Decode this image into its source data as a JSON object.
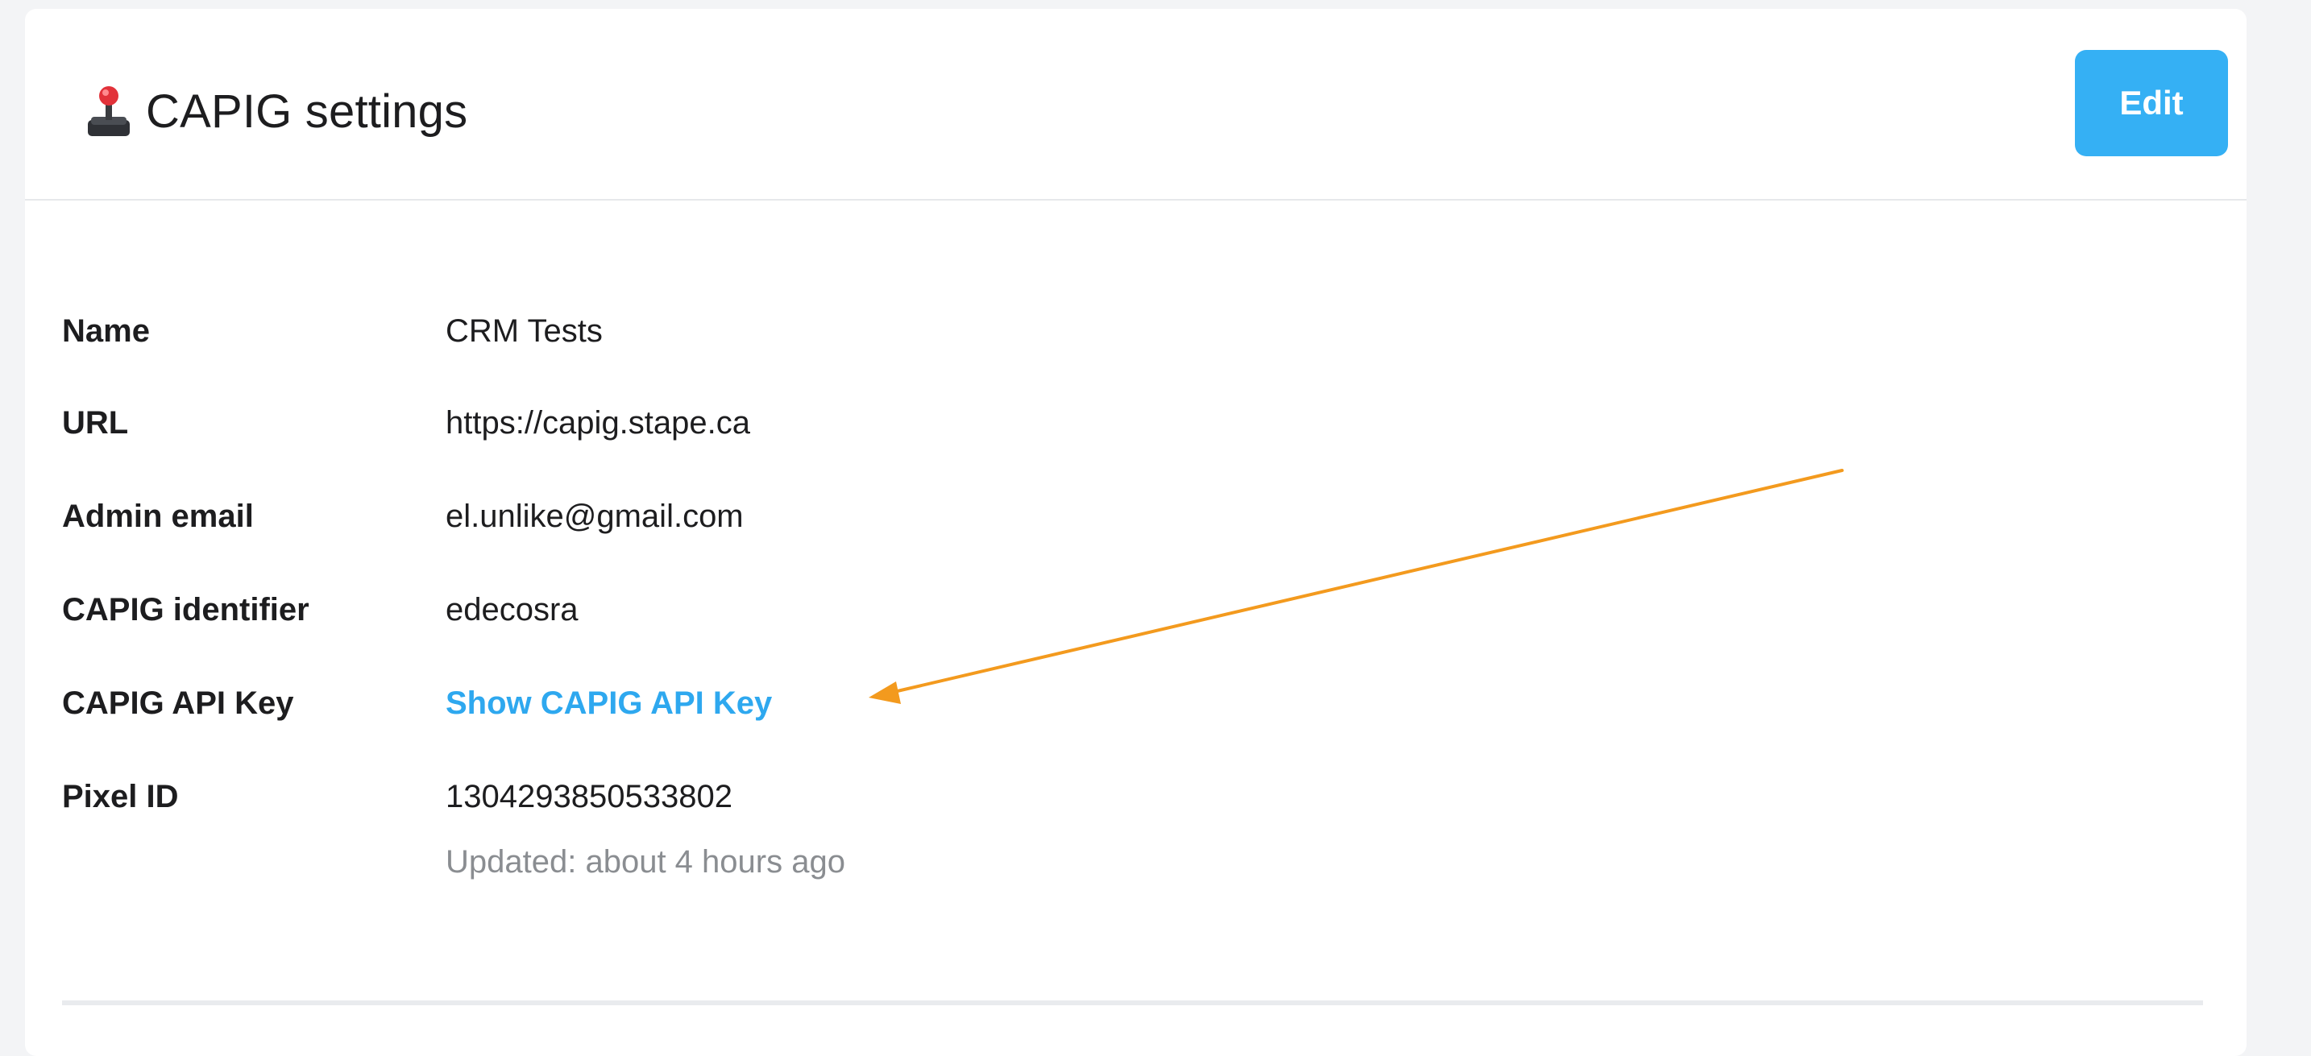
{
  "header": {
    "title": "CAPIG settings",
    "edit_label": "Edit"
  },
  "fields": [
    {
      "label": "Name",
      "value": "CRM Tests"
    },
    {
      "label": "URL",
      "value": "https://capig.stape.ca"
    },
    {
      "label": "Admin email",
      "value": "el.unlike@gmail.com"
    },
    {
      "label": "CAPIG identifier",
      "value": "edecosra"
    },
    {
      "label": "CAPIG API Key",
      "value": "Show CAPIG API Key"
    },
    {
      "label": "Pixel ID",
      "value": "1304293850533802"
    }
  ],
  "updated_text": "Updated: about 4 hours ago",
  "colors": {
    "accent": "#35b0f4",
    "link": "#2ea8ef",
    "annotation_arrow": "#f39a1e"
  },
  "icons": {
    "title_icon": "joystick-icon",
    "annotation": "arrow-icon"
  }
}
